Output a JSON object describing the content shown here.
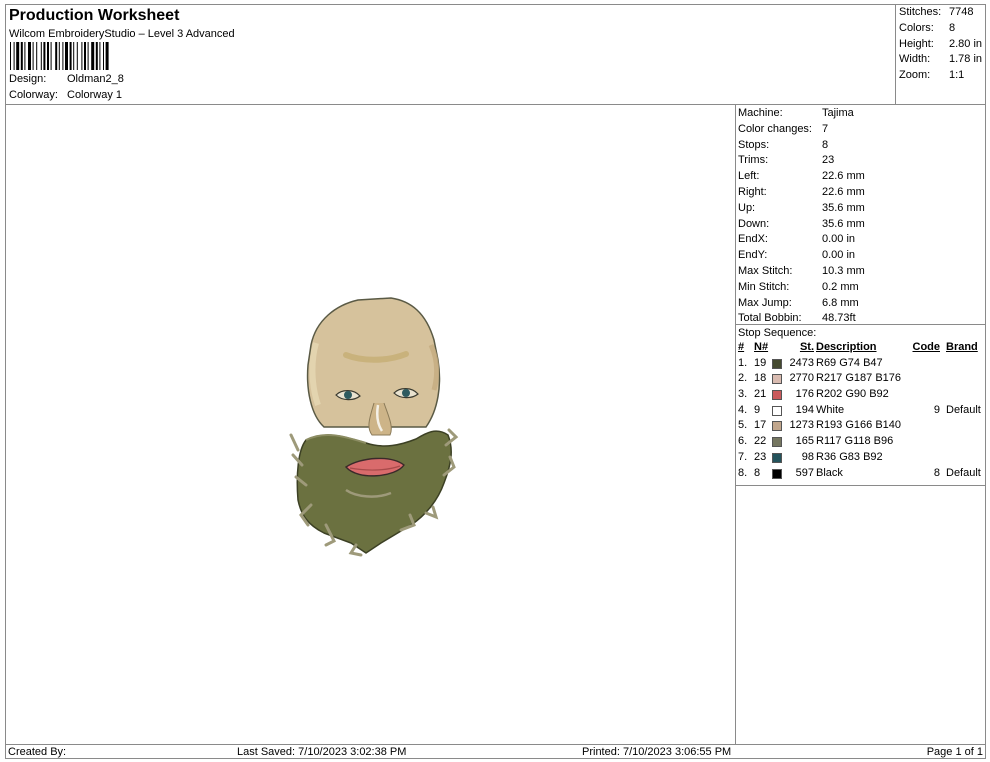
{
  "header": {
    "title": "Production Worksheet",
    "subtitle": "Wilcom EmbroideryStudio – Level 3 Advanced",
    "design_label": "Design:",
    "design_value": "Oldman2_8",
    "colorway_label": "Colorway:",
    "colorway_value": "Colorway 1"
  },
  "stats": {
    "stitches_label": "Stitches:",
    "stitches_value": "7748",
    "colors_label": "Colors:",
    "colors_value": "8",
    "height_label": "Height:",
    "height_value": "2.80 in",
    "width_label": "Width:",
    "width_value": "1.78 in",
    "zoom_label": "Zoom:",
    "zoom_value": "1:1"
  },
  "machine": [
    {
      "label": "Machine:",
      "value": "Tajima"
    },
    {
      "label": "Color changes:",
      "value": "7"
    },
    {
      "label": "Stops:",
      "value": "8"
    },
    {
      "label": "Trims:",
      "value": "23"
    },
    {
      "label": "Left:",
      "value": "22.6 mm"
    },
    {
      "label": "Right:",
      "value": "22.6 mm"
    },
    {
      "label": "Up:",
      "value": "35.6 mm"
    },
    {
      "label": "Down:",
      "value": "35.6 mm"
    },
    {
      "label": "EndX:",
      "value": "0.00 in"
    },
    {
      "label": "EndY:",
      "value": "0.00 in"
    },
    {
      "label": "Max Stitch:",
      "value": "10.3 mm"
    },
    {
      "label": "Min Stitch:",
      "value": "0.2 mm"
    },
    {
      "label": "Max Jump:",
      "value": "6.8 mm"
    },
    {
      "label": "Total Bobbin:",
      "value": "48.73ft"
    }
  ],
  "stop_sequence": {
    "title": "Stop Sequence:",
    "headers": {
      "idx": "#",
      "n": "N#",
      "st": "St.",
      "desc": "Description",
      "code": "Code",
      "brand": "Brand"
    },
    "rows": [
      {
        "idx": "1.",
        "n": "19",
        "color": "#454A2F",
        "st": "2473",
        "desc": "R69 G74 B47",
        "code": "",
        "brand": ""
      },
      {
        "idx": "2.",
        "n": "18",
        "color": "#D9BBB0",
        "st": "2770",
        "desc": "R217 G187 B176",
        "code": "",
        "brand": ""
      },
      {
        "idx": "3.",
        "n": "21",
        "color": "#CA5A5C",
        "st": "176",
        "desc": "R202 G90 B92",
        "code": "",
        "brand": ""
      },
      {
        "idx": "4.",
        "n": "9",
        "color": "#FFFFFF",
        "st": "194",
        "desc": "White",
        "code": "9",
        "brand": "Default"
      },
      {
        "idx": "5.",
        "n": "17",
        "color": "#C1A68C",
        "st": "1273",
        "desc": "R193 G166 B140",
        "code": "",
        "brand": ""
      },
      {
        "idx": "6.",
        "n": "22",
        "color": "#757660",
        "st": "165",
        "desc": "R117 G118 B96",
        "code": "",
        "brand": ""
      },
      {
        "idx": "7.",
        "n": "23",
        "color": "#24535C",
        "st": "98",
        "desc": "R36 G83 B92",
        "code": "",
        "brand": ""
      },
      {
        "idx": "8.",
        "n": "8",
        "color": "#000000",
        "st": "597",
        "desc": "Black",
        "code": "8",
        "brand": "Default"
      }
    ]
  },
  "footer": {
    "created": "Created By:",
    "saved": "Last Saved: 7/10/2023 3:02:38 PM",
    "printed": "Printed: 7/10/2023 3:06:55 PM",
    "page": "Page 1 of 1"
  }
}
